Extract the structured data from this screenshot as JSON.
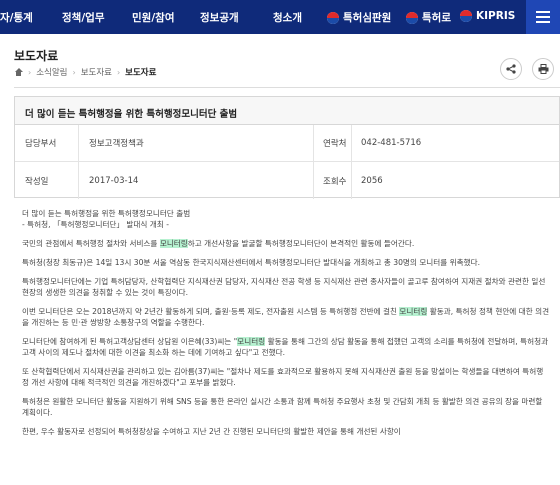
{
  "nav": {
    "items": [
      "자/통계",
      "정책/업무",
      "민원/참여",
      "정보공개",
      "청소개"
    ],
    "external": [
      "특허심판원",
      "특허로",
      "KIPRIS"
    ]
  },
  "page": {
    "title": "보도자료",
    "breadcrumb": [
      "소식알림",
      "보도자료",
      "보도자료"
    ]
  },
  "article": {
    "title": "더 많이 듣는 특허행정을 위한 특허행정모니터단 출범",
    "dept_label": "담당부서",
    "dept_value": "정보고객정책과",
    "contact_label": "연락처",
    "contact_value": "042-481-5716",
    "date_label": "작성일",
    "date_value": "2017-03-14",
    "views_label": "조회수",
    "views_value": "2056"
  },
  "body": {
    "p1a": "더 많이 듣는 특허행정을 위한 특허행정모니터단 출범",
    "p1b": "- 특허청, 「특허행정모니터단」 발대식 개최 -",
    "p2_pre": "국민의 관점에서 특허행정 절차와 서비스를 ",
    "p2_hl": "모니터링",
    "p2_post": "하고 개선사항을 발굴할 특허행정모니터단이 본격적인 활동에 들어간다.",
    "p3": "특허청(청장 최동규)은 14일 13시 30분 서울 역삼동 한국지식재산센터에서 특허행정모니터단 발대식을 개최하고 총 30명의 모니터를 위촉했다.",
    "p4": "특허행정모니터단에는 기업 특허담당자, 산학협력단 지식재산권 담당자, 지식재산 전공 학생 등 지식재산 관련 종사자들이 골고루 참여하여 지재권 절차와 관련한 일선 현장의 생생한 의견을 청취할 수 있는 것이 특징이다.",
    "p5_pre": "이번 모니터단은 오는 2018년까지 약 2년간 활동하게 되며, 출원·등록 제도, 전자출원 시스템 등 특허행정 전반에 걸친 ",
    "p5_hl": "모니터링",
    "p5_post": " 활동과, 특허청 정책 현안에 대한 의견을 개진하는 등 민·관 쌍방향 소통창구의 역할을 수행한다.",
    "p6_pre": "모니터단에 참여하게 된 특허고객상담센터 상담원 이은혜(33)씨는 \"",
    "p6_hl": "모니터링",
    "p6_post": " 활동을 통해 그간의 상담 활동을 통해 접했던 고객의 소리를 특허청에 전달하며, 특허청과 고객 사이의 제도나 절차에 대한 이견을 최소화 하는 데에 기여하고 싶다\"고 전했다.",
    "p7": "또 산학협력단에서 지식재산권을 관리하고 있는 김아름(37)씨는 \"절차나 제도를 효과적으로 활용하지 못해 지식재산권 출원 등을 망설이는 학생들을 대변하여 특허행정 개선 사항에 대해 적극적인 의견을 개진하겠다\"고 포부를 밝혔다.",
    "p8": "특허청은 원활한 모니터단 활동을 지원하기 위해 SNS 등을 통한 온라인 실시간 소통과 함께 특허청 주요행사 초청 및 간담회 개최 등 활발한 의견 공유의 장을 마련할 계획이다.",
    "p9": "한편, 우수 활동자로 선정되어 특허청장상을 수여하고 지난 2년 간 진행된 모니터단의 활발한 제안을 통해 개선된 사항이"
  },
  "icons": {
    "share": "share-icon",
    "print": "print-icon",
    "home": "home-icon",
    "menu": "hamburger-menu-icon"
  },
  "colors": {
    "nav_bg": "#0f2a7a",
    "highlight": "#b6f1d0"
  }
}
